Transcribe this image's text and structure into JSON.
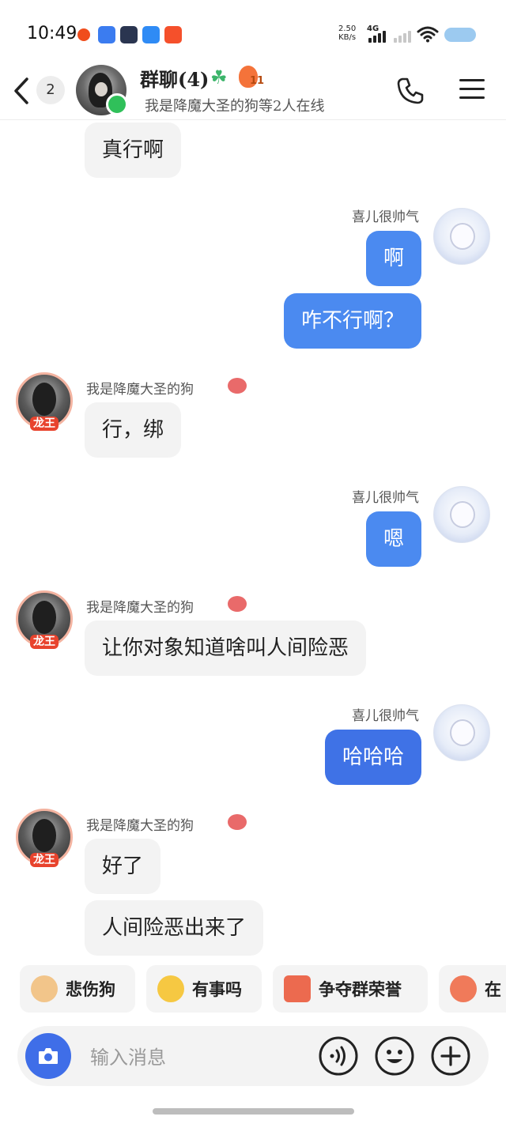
{
  "status_bar": {
    "time": "10:49",
    "net_speed": "2.50",
    "net_unit": "KB/s",
    "network": "4G"
  },
  "header": {
    "unread_count": "2",
    "group_title": "群聊(4)",
    "fire_badge": "11",
    "online_status": "我是降魔大圣的狗等2人在线"
  },
  "messages": [
    {
      "side": "left",
      "text": "真行啊"
    },
    {
      "side": "right",
      "sender": "喜儿很帅气",
      "texts": [
        "啊",
        "咋不行啊？"
      ]
    },
    {
      "side": "left",
      "sender": "我是降魔大圣的狗",
      "avatar_badge": "龙王",
      "texts": [
        "行，绑"
      ]
    },
    {
      "side": "right",
      "sender": "喜儿很帅气",
      "texts": [
        "嗯"
      ]
    },
    {
      "side": "left",
      "sender": "我是降魔大圣的狗",
      "avatar_badge": "龙王",
      "texts": [
        "让你对象知道啥叫人间险恶"
      ]
    },
    {
      "side": "right",
      "sender": "喜儿很帅气",
      "texts": [
        "哈哈哈"
      ]
    },
    {
      "side": "left",
      "sender": "我是降魔大圣的狗",
      "avatar_badge": "龙王",
      "texts": [
        "好了",
        "人间险恶出来了"
      ]
    }
  ],
  "quick_replies": [
    "悲伤狗",
    "有事吗",
    "争夺群荣誉",
    "在"
  ],
  "input": {
    "placeholder": "输入消息"
  },
  "colors": {
    "accent": "#4b8af0",
    "bubble_right": "#4b8af0",
    "bubble_left": "#f3f3f3",
    "camera": "#3f6ee8"
  }
}
